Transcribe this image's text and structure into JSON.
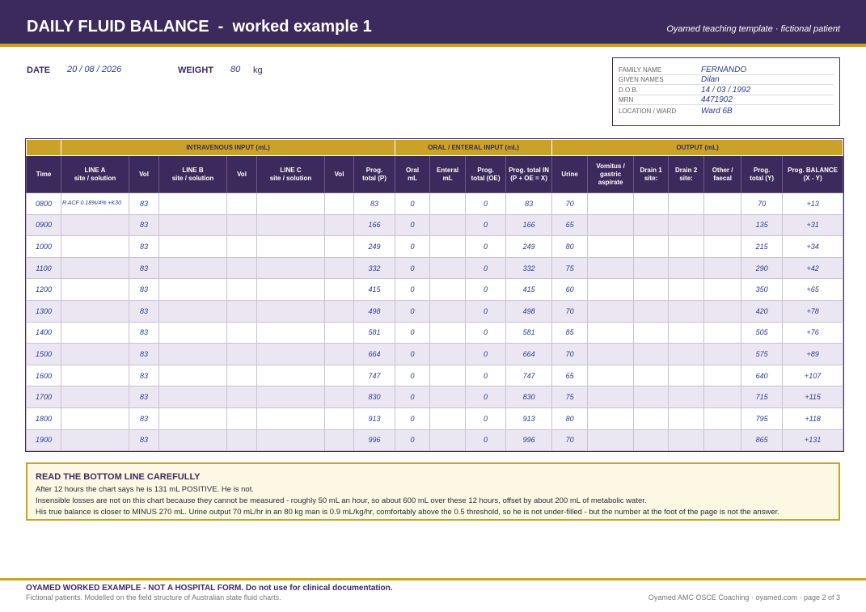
{
  "header": {
    "title": "DAILY FLUID BALANCE  -  worked example 1",
    "subtitle": "Oyamed teaching template  ·  fictional patient"
  },
  "meta": {
    "date_label": "DATE",
    "date_value": "20 / 08 / 2026",
    "weight_label": "WEIGHT",
    "weight_value": "80",
    "weight_unit": "kg"
  },
  "patient": [
    {
      "label": "FAMILY NAME",
      "value": "FERNANDO"
    },
    {
      "label": "GIVEN NAMES",
      "value": "Dilan"
    },
    {
      "label": "D.O.B.",
      "value": "14 / 03 / 1992"
    },
    {
      "label": "MRN",
      "value": "4471902"
    },
    {
      "label": "LOCATION / WARD",
      "value": "Ward 6B"
    }
  ],
  "table": {
    "groups": {
      "iv": "INTRAVENOUS INPUT (mL)",
      "oral": "ORAL / ENTERAL INPUT (mL)",
      "output": "OUTPUT (mL)"
    },
    "columns": [
      [
        "Time",
        ""
      ],
      [
        "LINE A",
        "site / solution"
      ],
      [
        "Vol",
        ""
      ],
      [
        "LINE B",
        "site / solution"
      ],
      [
        "Vol",
        ""
      ],
      [
        "LINE C",
        "site / solution"
      ],
      [
        "Vol",
        ""
      ],
      [
        "Prog.",
        "total (P)"
      ],
      [
        "Oral",
        "mL"
      ],
      [
        "Enteral",
        "mL"
      ],
      [
        "Prog.",
        "total (OE)"
      ],
      [
        "Prog. total IN",
        "(P + OE = X)"
      ],
      [
        "Urine",
        ""
      ],
      [
        "Vomitus /",
        "gastric aspirate"
      ],
      [
        "Drain 1",
        "site:"
      ],
      [
        "Drain 2",
        "site:"
      ],
      [
        "Other /",
        "faecal"
      ],
      [
        "Prog.",
        "total (Y)"
      ],
      [
        "Prog. BALANCE",
        "(X - Y)"
      ]
    ],
    "rows": [
      [
        "0800",
        "R ACF  0.18%/4% +K30",
        "83",
        "",
        "",
        "",
        "",
        "83",
        "0",
        "",
        "0",
        "83",
        "70",
        "",
        "",
        "",
        "",
        "70",
        "+13"
      ],
      [
        "0900",
        "",
        "83",
        "",
        "",
        "",
        "",
        "166",
        "0",
        "",
        "0",
        "166",
        "65",
        "",
        "",
        "",
        "",
        "135",
        "+31"
      ],
      [
        "1000",
        "",
        "83",
        "",
        "",
        "",
        "",
        "249",
        "0",
        "",
        "0",
        "249",
        "80",
        "",
        "",
        "",
        "",
        "215",
        "+34"
      ],
      [
        "1100",
        "",
        "83",
        "",
        "",
        "",
        "",
        "332",
        "0",
        "",
        "0",
        "332",
        "75",
        "",
        "",
        "",
        "",
        "290",
        "+42"
      ],
      [
        "1200",
        "",
        "83",
        "",
        "",
        "",
        "",
        "415",
        "0",
        "",
        "0",
        "415",
        "60",
        "",
        "",
        "",
        "",
        "350",
        "+65"
      ],
      [
        "1300",
        "",
        "83",
        "",
        "",
        "",
        "",
        "498",
        "0",
        "",
        "0",
        "498",
        "70",
        "",
        "",
        "",
        "",
        "420",
        "+78"
      ],
      [
        "1400",
        "",
        "83",
        "",
        "",
        "",
        "",
        "581",
        "0",
        "",
        "0",
        "581",
        "85",
        "",
        "",
        "",
        "",
        "505",
        "+76"
      ],
      [
        "1500",
        "",
        "83",
        "",
        "",
        "",
        "",
        "664",
        "0",
        "",
        "0",
        "664",
        "70",
        "",
        "",
        "",
        "",
        "575",
        "+89"
      ],
      [
        "1600",
        "",
        "83",
        "",
        "",
        "",
        "",
        "747",
        "0",
        "",
        "0",
        "747",
        "65",
        "",
        "",
        "",
        "",
        "640",
        "+107"
      ],
      [
        "1700",
        "",
        "83",
        "",
        "",
        "",
        "",
        "830",
        "0",
        "",
        "0",
        "830",
        "75",
        "",
        "",
        "",
        "",
        "715",
        "+115"
      ],
      [
        "1800",
        "",
        "83",
        "",
        "",
        "",
        "",
        "913",
        "0",
        "",
        "0",
        "913",
        "80",
        "",
        "",
        "",
        "",
        "795",
        "+118"
      ],
      [
        "1900",
        "",
        "83",
        "",
        "",
        "",
        "",
        "996",
        "0",
        "",
        "0",
        "996",
        "70",
        "",
        "",
        "",
        "",
        "865",
        "+131"
      ]
    ]
  },
  "note": {
    "title": "READ THE BOTTOM LINE CAREFULLY",
    "lines": [
      "After 12 hours the chart says he is 131 mL POSITIVE.  He is not.",
      "Insensible losses are not on this chart because they cannot be measured - roughly 50 mL an hour, so about 600 mL over these 12 hours, offset by about 200 mL of metabolic water.",
      "His true balance is closer to MINUS 270 mL.  Urine output 70 mL/hr in an 80 kg man is 0.9 mL/kg/hr, comfortably above the 0.5 threshold, so he is not under-filled - but the number at the foot of the page is not the answer."
    ]
  },
  "footer": {
    "main": "OYAMED WORKED EXAMPLE  -  NOT A HOSPITAL FORM.  Do not use for clinical documentation.",
    "sub": "Fictional patients. Modelled on the field structure of Australian state fluid charts.",
    "right": "Oyamed AMC OSCE Coaching  ·  oyamed.com  ·  page 2 of 3"
  },
  "colors": {
    "brand": "#3d2a5c",
    "accent": "#c9a227",
    "ink": "#2b3a8f",
    "note_bg": "#fdf8e4"
  }
}
